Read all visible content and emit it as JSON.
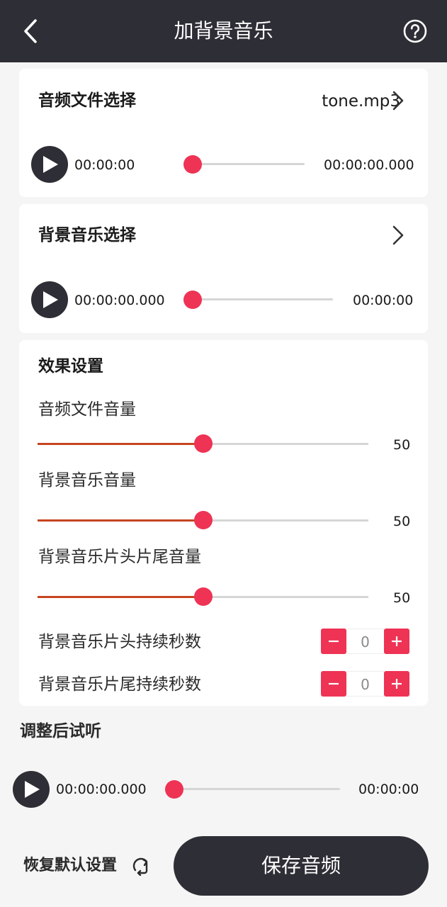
{
  "header": {
    "title": "加背景音乐",
    "back_icon": "chevron-left-icon",
    "help_icon": "help-circle-icon"
  },
  "audio_file": {
    "label": "音频文件选择",
    "file_name": "tone.mp3",
    "current_time": "00:00:00",
    "total_time": "00:00:00.000"
  },
  "background_music": {
    "label": "背景音乐选择",
    "current_time": "00:00:00.000",
    "total_time": "00:00:00"
  },
  "effects": {
    "title": "效果设置",
    "audio_volume": {
      "label": "音频文件音量",
      "value": "50"
    },
    "bg_volume": {
      "label": "背景音乐音量",
      "value": "50"
    },
    "fade_volume": {
      "label": "背景音乐片头片尾音量",
      "value": "50"
    },
    "head_seconds": {
      "label": "背景音乐片头持续秒数",
      "value": "0"
    },
    "tail_seconds": {
      "label": "背景音乐片尾持续秒数",
      "value": "0"
    }
  },
  "preview": {
    "title": "调整后试听",
    "current_time": "00:00:00.000",
    "total_time": "00:00:00"
  },
  "footer": {
    "reset_label": "恢复默认设置",
    "save_label": "保存音频"
  },
  "colors": {
    "accent": "#ee3355",
    "dark": "#2e2e36",
    "slider_fill": "#c64520"
  }
}
